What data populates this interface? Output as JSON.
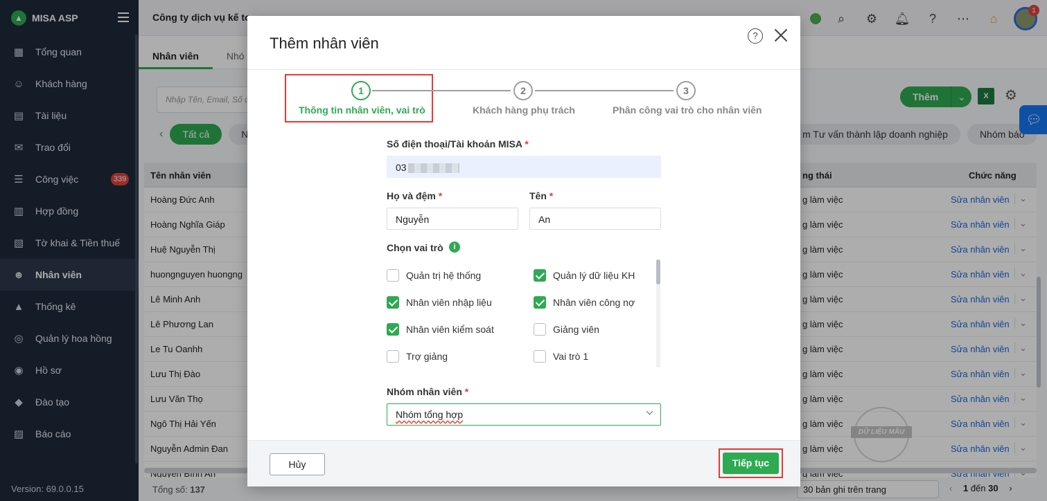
{
  "app": {
    "brand": "MISA ASP",
    "version": "Version: 69.0.0.15"
  },
  "sidebar": {
    "items": [
      {
        "label": "Tổng quan",
        "icon": "dashboard-icon"
      },
      {
        "label": "Khách hàng",
        "icon": "user-icon"
      },
      {
        "label": "Tài liệu",
        "icon": "document-icon"
      },
      {
        "label": "Trao đổi",
        "icon": "chat-icon"
      },
      {
        "label": "Công việc",
        "icon": "tasks-icon",
        "badge": "339"
      },
      {
        "label": "Hợp đồng",
        "icon": "contract-icon"
      },
      {
        "label": "Tờ khai & Tiền thuế",
        "icon": "tax-icon"
      },
      {
        "label": "Nhân viên",
        "icon": "employees-icon",
        "active": true
      },
      {
        "label": "Thống kê",
        "icon": "chart-icon"
      },
      {
        "label": "Quản lý hoa hồng",
        "icon": "commission-icon"
      },
      {
        "label": "Hồ sơ",
        "icon": "profile-icon"
      },
      {
        "label": "Đào tạo",
        "icon": "training-icon"
      },
      {
        "label": "Báo cáo",
        "icon": "report-icon"
      }
    ]
  },
  "topbar": {
    "company": "Công ty dịch vụ kế to",
    "notification_count": "1"
  },
  "page": {
    "tabs": [
      "Nhân viên",
      "Nhó"
    ],
    "search_placeholder": "Nhập Tên, Email, Số đ",
    "filter_chips": [
      "Tất cả",
      "N"
    ],
    "filter_chips_right": [
      "m Tư vấn thành lập doanh nghiệp",
      "Nhóm báo"
    ],
    "add_label": "Thêm",
    "excel_label": "X",
    "columns": {
      "name": "Tên nhân viên",
      "status": "ng thái",
      "action": "Chức năng"
    },
    "rows": [
      {
        "name": "Hoàng Đức Anh",
        "status": "g làm việc",
        "action": "Sửa nhân viên"
      },
      {
        "name": "Hoàng Nghĩa Giáp",
        "status": "g làm việc",
        "action": "Sửa nhân viên"
      },
      {
        "name": "Huệ Nguyễn Thị",
        "status": "g làm việc",
        "action": "Sửa nhân viên"
      },
      {
        "name": "huongnguyen huongng",
        "status": "g làm việc",
        "action": "Sửa nhân viên"
      },
      {
        "name": "Lê Minh Anh",
        "status": "g làm việc",
        "action": "Sửa nhân viên"
      },
      {
        "name": "Lê Phương Lan",
        "status": "g làm việc",
        "action": "Sửa nhân viên"
      },
      {
        "name": "Le Tu Oanhh",
        "status": "g làm việc",
        "action": "Sửa nhân viên"
      },
      {
        "name": "Lưu Thị Đào",
        "status": "g làm việc",
        "action": "Sửa nhân viên"
      },
      {
        "name": "Lưu Văn Thọ",
        "status": "g làm việc",
        "action": "Sửa nhân viên"
      },
      {
        "name": "Ngô Thị Hải Yến",
        "status": "g làm việc",
        "action": "Sửa nhân viên"
      },
      {
        "name": "Nguyễn Admin Đan",
        "status": "g làm việc",
        "action": "Sửa nhân viên"
      },
      {
        "name": "Nguyễn Bình An",
        "status": "g làm việc",
        "action": "Sửa nhân viên"
      }
    ],
    "total_label": "Tổng số:",
    "total": "137",
    "per_page": "30 bản ghi trên trang",
    "pager_from": "1",
    "pager_to_label": "đến",
    "pager_to": "30"
  },
  "modal": {
    "title": "Thêm nhân viên",
    "steps": [
      {
        "num": "1",
        "label": "Thông tin nhân viên, vai trò",
        "active": true
      },
      {
        "num": "2",
        "label": "Khách hàng phụ trách"
      },
      {
        "num": "3",
        "label": "Phân công vai trò cho nhân viên"
      }
    ],
    "phone_label": "Số điện thoại/Tài khoản MISA",
    "phone_value": "03",
    "lastname_label": "Họ và đệm",
    "lastname_value": "Nguyễn",
    "firstname_label": "Tên",
    "firstname_value": "An",
    "roles_label": "Chọn vai trò",
    "roles": [
      {
        "label": "Quản trị hệ thống",
        "checked": false
      },
      {
        "label": "Quản lý dữ liệu KH",
        "checked": true
      },
      {
        "label": "Nhân viên nhập liệu",
        "checked": true
      },
      {
        "label": "Nhân viên công nợ",
        "checked": true
      },
      {
        "label": "Nhân viên kiểm soát",
        "checked": true
      },
      {
        "label": "Giảng viên",
        "checked": false
      },
      {
        "label": "Trợ giảng",
        "checked": false
      },
      {
        "label": "Vai trò 1",
        "checked": false
      }
    ],
    "group_label": "Nhóm nhân viên",
    "group_value": "Nhóm tổng hợp",
    "required_mark": "*",
    "cancel_label": "Hủy",
    "next_label": "Tiếp tục"
  },
  "watermark": "DỮ LIỆU MẪU",
  "colors": {
    "primary": "#2eaa52",
    "sidebar": "#1e2a3b",
    "highlight": "#e53935",
    "link": "#1a66d6"
  }
}
